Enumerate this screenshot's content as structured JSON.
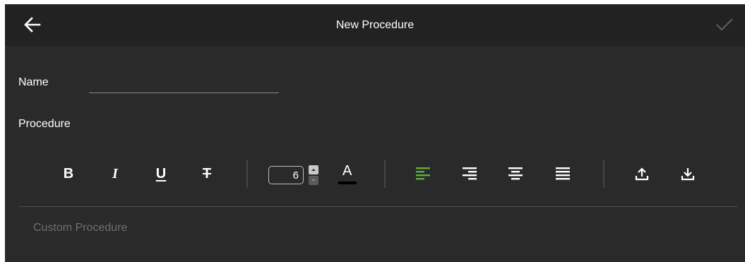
{
  "header": {
    "title": "New Procedure",
    "back_icon": "arrow-left-icon",
    "confirm_icon": "checkmark-icon"
  },
  "form": {
    "name_label": "Name",
    "name_value": "",
    "procedure_label": "Procedure"
  },
  "toolbar": {
    "bold_label": "B",
    "italic_label": "I",
    "underline_label": "U",
    "strikethrough_label": "T",
    "font_size": "6",
    "text_color_label": "A",
    "text_color": "#000000",
    "active_align": "align-left",
    "active_color": "#5fae3e",
    "icons": [
      "bold-icon",
      "italic-icon",
      "underline-icon",
      "strikethrough-icon",
      "font-color-icon",
      "align-left-icon",
      "align-right-icon",
      "align-center-icon",
      "align-justify-icon",
      "upload-icon",
      "download-icon"
    ]
  },
  "editor": {
    "placeholder": "Custom Procedure"
  }
}
